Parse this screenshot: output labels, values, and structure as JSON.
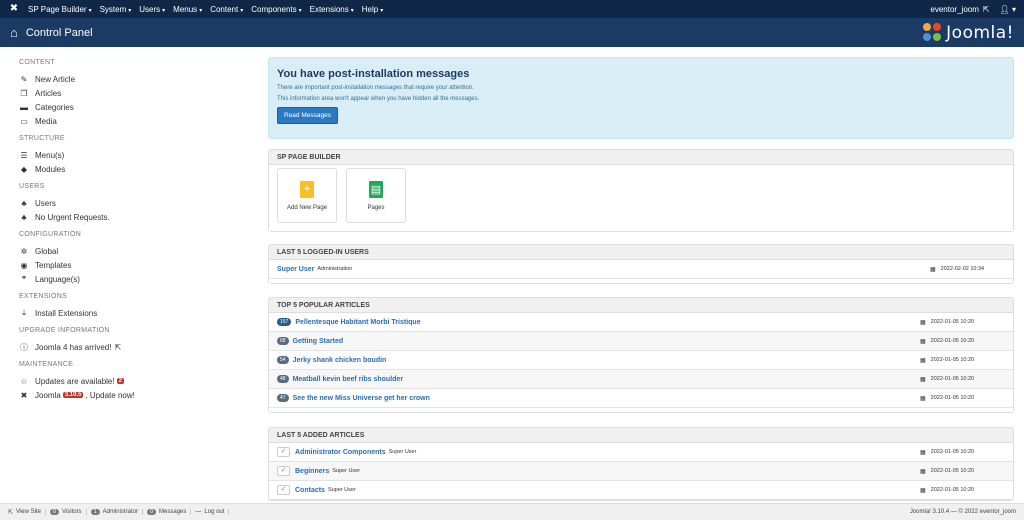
{
  "navbar": {
    "menu": [
      {
        "label": "SP Page Builder"
      },
      {
        "label": "System"
      },
      {
        "label": "Users"
      },
      {
        "label": "Menus"
      },
      {
        "label": "Content"
      },
      {
        "label": "Components"
      },
      {
        "label": "Extensions"
      },
      {
        "label": "Help"
      }
    ],
    "username": "eventor_joom"
  },
  "header": {
    "title": "Control Panel",
    "logo_text": "Joomla!"
  },
  "sidebar": {
    "content_head": "CONTENT",
    "new_article": "New Article",
    "articles": "Articles",
    "categories": "Categories",
    "media": "Media",
    "structure_head": "STRUCTURE",
    "menus": "Menu(s)",
    "modules": "Modules",
    "users_head": "USERS",
    "users": "Users",
    "no_urgent": "No Urgent Requests.",
    "config_head": "CONFIGURATION",
    "global": "Global",
    "templates": "Templates",
    "languages": "Language(s)",
    "extensions_head": "EXTENSIONS",
    "install_ext": "Install Extensions",
    "upgrade_head": "UPGRADE INFORMATION",
    "joomla4": "Joomla 4 has arrived!",
    "maintenance_head": "MAINTENANCE",
    "updates_available": "Updates are available!",
    "updates_count": "2",
    "joomla_prefix": "Joomla",
    "joomla_version_badge": "3.10.5",
    "update_now": ", Update now!"
  },
  "alert": {
    "title": "You have post-installation messages",
    "line1": "There are important post-installation messages that require your attention.",
    "line2": "This information area won't appear when you have hidden all the messages.",
    "button": "Read Messages"
  },
  "spb": {
    "header": "SP PAGE BUILDER",
    "add_new_page": "Add New Page",
    "pages": "Pages"
  },
  "logged_in": {
    "header": "LAST 5 LOGGED-IN USERS",
    "rows": [
      {
        "name": "Super User",
        "meta": "Administration",
        "date": "2022-02-02 10:34"
      }
    ]
  },
  "popular": {
    "header": "TOP 5 POPULAR ARTICLES",
    "rows": [
      {
        "hits": "157",
        "title": "Pellentesque Habitant Morbi Tristique",
        "date": "2022-01-05 10:20"
      },
      {
        "hits": "68",
        "title": "Getting Started",
        "date": "2022-01-05 10:20"
      },
      {
        "hits": "54",
        "title": "Jerky shank chicken boudin",
        "date": "2022-01-05 10:20"
      },
      {
        "hits": "48",
        "title": "Meatball kevin beef ribs shoulder",
        "date": "2022-01-05 10:20"
      },
      {
        "hits": "47",
        "title": "See the new Miss Universe get her crown",
        "date": "2022-01-05 10:20"
      }
    ]
  },
  "added": {
    "header": "LAST 5 ADDED ARTICLES",
    "rows": [
      {
        "title": "Administrator Components",
        "author": "Super User",
        "date": "2022-01-05 10:20"
      },
      {
        "title": "Beginners",
        "author": "Super User",
        "date": "2022-01-05 10:20"
      },
      {
        "title": "Contacts",
        "author": "Super User",
        "date": "2022-01-05 10:20"
      }
    ]
  },
  "footer": {
    "view_site": "View Site",
    "visitors_count": "0",
    "visitors": "Visitors",
    "admin_count": "1",
    "administrator": "Administrator",
    "messages_count": "0",
    "messages": "Messages",
    "logout": "Log out",
    "version": "Joomla! 3.10.4 — © 2022 eventor_joom"
  },
  "colors": {
    "navbar_bg": "#0f2847",
    "header_bg": "#1b3b65",
    "alert_bg": "#d9edf7",
    "button_blue": "#2a7ac3",
    "link_blue": "#2a6db0",
    "badge_red": "#bd362f"
  }
}
